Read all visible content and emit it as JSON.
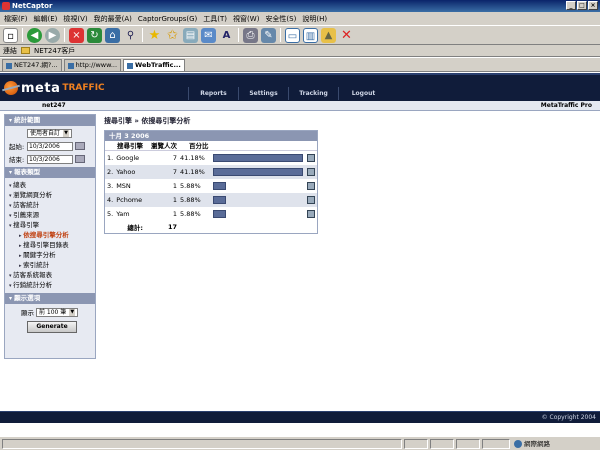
{
  "window": {
    "title": "NetCaptor"
  },
  "menu": [
    "檔案(F)",
    "編輯(E)",
    "檢視(V)",
    "我的最愛(A)",
    "CaptorGroups(G)",
    "工具(T)",
    "視窗(W)",
    "安全性(S)",
    "說明(H)"
  ],
  "toolbar": {
    "icons": [
      "new-doc-icon",
      "back-icon",
      "forward-icon",
      "stop-icon",
      "refresh-icon",
      "home-icon",
      "search-icon",
      "favorites-icon",
      "add-favorite-icon",
      "history-icon",
      "mail-icon",
      "font-icon",
      "print-icon",
      "edit-icon",
      "cascade-icon",
      "tile-icon",
      "lock-icon",
      "close-all-icon"
    ]
  },
  "links": {
    "label": "連結",
    "item": "NET247客戶"
  },
  "tabs": [
    {
      "label": "NET247.網?..."
    },
    {
      "label": "http://www..."
    },
    {
      "label": "WebTraffic..."
    }
  ],
  "header": {
    "logo_meta": "meta",
    "logo_traffic": "TRAFFIC",
    "nav": [
      "Reports",
      "Settings",
      "Tracking",
      "Logout"
    ]
  },
  "subheader": {
    "account": "net247",
    "product": "MetaTraffic Pro"
  },
  "sidebar": {
    "stats_range_title": "統計範圍",
    "range_select": "使用者自訂",
    "start_label": "起始:",
    "start_date": "10/3/2006",
    "end_label": "結束:",
    "end_date": "10/3/2006",
    "report_types_title": "報表類型",
    "menu": [
      {
        "label": "總表",
        "sub": false,
        "active": false
      },
      {
        "label": "瀏覽網頁分析",
        "sub": false,
        "active": false
      },
      {
        "label": "訪客統計",
        "sub": false,
        "active": false
      },
      {
        "label": "引薦來源",
        "sub": false,
        "active": false
      },
      {
        "label": "搜尋引擎",
        "sub": false,
        "active": false
      },
      {
        "label": "依搜尋引擎分析",
        "sub": true,
        "active": true
      },
      {
        "label": "搜尋引擎目錄表",
        "sub": true,
        "active": false
      },
      {
        "label": "關鍵字分析",
        "sub": true,
        "active": false
      },
      {
        "label": "索引統計",
        "sub": true,
        "active": false
      },
      {
        "label": "訪客系統報表",
        "sub": false,
        "active": false
      },
      {
        "label": "行銷統計分析",
        "sub": false,
        "active": false
      }
    ],
    "display_options_title": "顯示選項",
    "show_label": "顯示",
    "show_select": "前 100 筆",
    "generate_label": "Generate"
  },
  "main": {
    "breadcrumb": "搜尋引擎 » 依搜尋引擎分析",
    "date_header": "十月 3 2006",
    "col_engine": "搜尋引擎",
    "col_visits": "瀏覽人次",
    "col_percent": "百分比",
    "rows": [
      {
        "rank": "1.",
        "engine": "Google",
        "visits": "7",
        "percent": "41.18%",
        "share": 0.4118
      },
      {
        "rank": "2.",
        "engine": "Yahoo",
        "visits": "7",
        "percent": "41.18%",
        "share": 0.4118
      },
      {
        "rank": "3.",
        "engine": "MSN",
        "visits": "1",
        "percent": "5.88%",
        "share": 0.0588
      },
      {
        "rank": "4.",
        "engine": "Pchome",
        "visits": "1",
        "percent": "5.88%",
        "share": 0.0588
      },
      {
        "rank": "5.",
        "engine": "Yam",
        "visits": "1",
        "percent": "5.88%",
        "share": 0.0588
      }
    ],
    "total_label": "總計:",
    "total_value": "17"
  },
  "footer": {
    "copyright": "© Copyright 2004"
  },
  "status": {
    "zone": "網際網路"
  }
}
